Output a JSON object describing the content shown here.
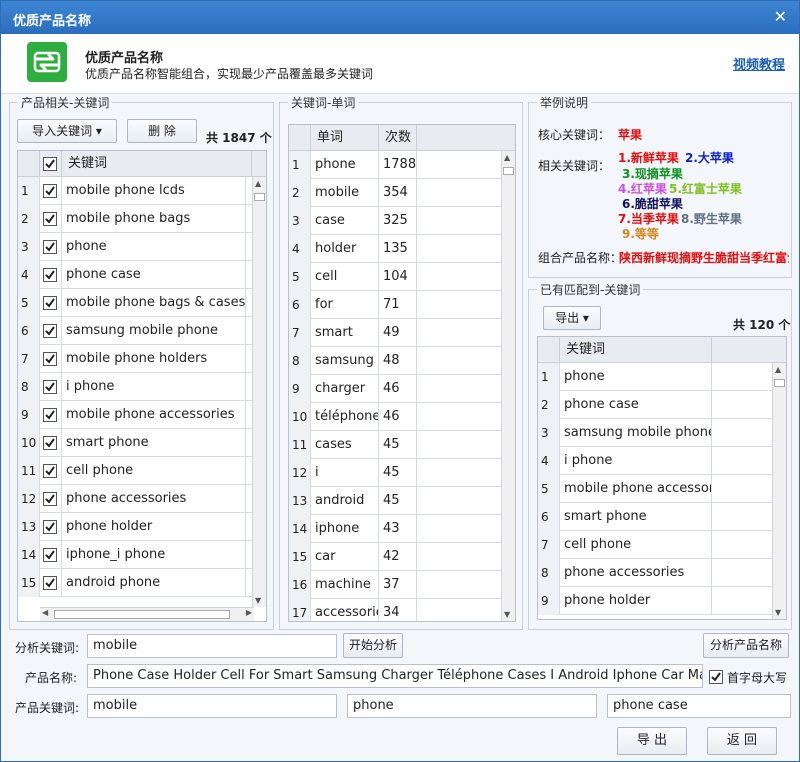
{
  "window": {
    "title": "优质产品名称",
    "close": "✕"
  },
  "header": {
    "title": "优质产品名称",
    "subtitle": "优质产品名称智能组合，实现最少产品覆盖最多关键词",
    "video_link": "视频教程"
  },
  "left": {
    "label": "产品相关-关键词",
    "import_btn": "导入关键词 ▾",
    "delete_btn": "删 除",
    "count": "共 1847 个",
    "header": "关键词",
    "rows": [
      {
        "n": "1",
        "kw": "mobile phone lcds"
      },
      {
        "n": "2",
        "kw": "mobile phone bags"
      },
      {
        "n": "3",
        "kw": "phone"
      },
      {
        "n": "4",
        "kw": "phone case"
      },
      {
        "n": "5",
        "kw": "mobile phone bags & cases"
      },
      {
        "n": "6",
        "kw": "samsung mobile phone"
      },
      {
        "n": "7",
        "kw": "mobile phone holders"
      },
      {
        "n": "8",
        "kw": "i phone"
      },
      {
        "n": "9",
        "kw": "mobile phone accessories"
      },
      {
        "n": "10",
        "kw": "smart phone"
      },
      {
        "n": "11",
        "kw": "cell phone"
      },
      {
        "n": "12",
        "kw": "phone accessories"
      },
      {
        "n": "13",
        "kw": "phone holder"
      },
      {
        "n": "14",
        "kw": "iphone_i phone"
      },
      {
        "n": "15",
        "kw": "android phone"
      }
    ]
  },
  "mid": {
    "label": "关键词-单词",
    "h_word": "单词",
    "h_count": "次数",
    "rows": [
      {
        "n": "1",
        "w": "phone",
        "c": "1788"
      },
      {
        "n": "2",
        "w": "mobile",
        "c": "354"
      },
      {
        "n": "3",
        "w": "case",
        "c": "325"
      },
      {
        "n": "4",
        "w": "holder",
        "c": "135"
      },
      {
        "n": "5",
        "w": "cell",
        "c": "104"
      },
      {
        "n": "6",
        "w": "for",
        "c": "71"
      },
      {
        "n": "7",
        "w": "smart",
        "c": "49"
      },
      {
        "n": "8",
        "w": "samsung",
        "c": "48"
      },
      {
        "n": "9",
        "w": "charger",
        "c": "46"
      },
      {
        "n": "10",
        "w": "téléphone",
        "c": "46"
      },
      {
        "n": "11",
        "w": "cases",
        "c": "45"
      },
      {
        "n": "12",
        "w": "i",
        "c": "45"
      },
      {
        "n": "13",
        "w": "android",
        "c": "45"
      },
      {
        "n": "14",
        "w": "iphone",
        "c": "43"
      },
      {
        "n": "15",
        "w": "car",
        "c": "42"
      },
      {
        "n": "16",
        "w": "machine",
        "c": "37"
      },
      {
        "n": "17",
        "w": "accessories",
        "c": "34"
      }
    ]
  },
  "example": {
    "label": "举例说明",
    "core_label": "核心关键词：",
    "core_value": "苹果",
    "related_label": "相关关键词：",
    "items": [
      {
        "text": "1.新鲜苹果",
        "color": "#e01010"
      },
      {
        "text": "2.大苹果",
        "color": "#1020c8"
      },
      {
        "text": "3.现摘苹果",
        "color": "#109020"
      },
      {
        "text": "4.红苹果",
        "color": "#d050d8"
      },
      {
        "text": "5.红富士苹果",
        "color": "#80c020"
      },
      {
        "text": "6.脆甜苹果",
        "color": "#101060"
      },
      {
        "text": "7.当季苹果",
        "color": "#e01010"
      },
      {
        "text": "8.野生苹果",
        "color": "#607080"
      },
      {
        "text": "9.等等",
        "color": "#d08820"
      }
    ],
    "combo_label": "组合产品名称：",
    "combo_value": "陕西新鲜现摘野生脆甜当季红富士"
  },
  "matched": {
    "label": "已有匹配到-关键词",
    "export_btn": "导出 ▾",
    "count": "共 120 个",
    "header": "关键词",
    "rows": [
      {
        "n": "1",
        "kw": "phone"
      },
      {
        "n": "2",
        "kw": "phone case"
      },
      {
        "n": "3",
        "kw": "samsung mobile phone"
      },
      {
        "n": "4",
        "kw": "i phone"
      },
      {
        "n": "5",
        "kw": "mobile phone accessories"
      },
      {
        "n": "6",
        "kw": "smart phone"
      },
      {
        "n": "7",
        "kw": "cell phone"
      },
      {
        "n": "8",
        "kw": "phone accessories"
      },
      {
        "n": "9",
        "kw": "phone holder"
      }
    ]
  },
  "bottom": {
    "analyze_label": "分析关键词:",
    "analyze_value": "mobile",
    "start_btn": "开始分析",
    "analyze_name_btn": "分析产品名称",
    "name_label": "产品名称:",
    "name_value": "Phone Case Holder Cell For Smart Samsung Charger Téléphone Cases I Android Iphone Car Machine Accessories",
    "capitalize_label": "首字母大写",
    "kw_label": "产品关键词:",
    "kw1": "mobile",
    "kw2": "phone",
    "kw3": "phone case",
    "export_btn": "导 出",
    "back_btn": "返 回"
  }
}
